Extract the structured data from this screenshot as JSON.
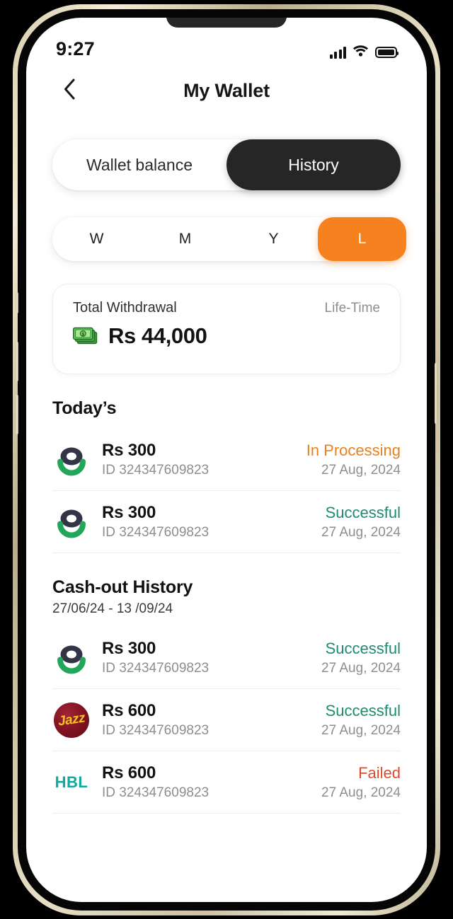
{
  "status_bar": {
    "time": "9:27",
    "signal_icon": "signal-bars-icon",
    "wifi_icon": "wifi-icon",
    "battery_icon": "battery-full-icon"
  },
  "header": {
    "back_icon": "chevron-left-icon",
    "title": "My Wallet"
  },
  "wallet_tabs": {
    "items": [
      {
        "label": "Wallet balance",
        "active": false
      },
      {
        "label": "History",
        "active": true
      }
    ],
    "active_bg": "#262626"
  },
  "period_tabs": {
    "items": [
      {
        "label": "W",
        "active": false
      },
      {
        "label": "M",
        "active": false
      },
      {
        "label": "Y",
        "active": false
      },
      {
        "label": "L",
        "active": true
      }
    ],
    "active_bg": "#F5821F"
  },
  "summary": {
    "label": "Total Withdrawal",
    "period": "Life-Time",
    "icon": "money-banknotes-icon",
    "amount": "Rs 44,000"
  },
  "today_section": {
    "heading": "Today’s",
    "rows": [
      {
        "logo": "easypaisa-logo",
        "amount": "Rs 300",
        "id": "ID 324347609823",
        "status": "In Processing",
        "status_kind": "processing",
        "status_color": "#E8821E",
        "date": "27 Aug, 2024"
      },
      {
        "logo": "easypaisa-logo",
        "amount": "Rs 300",
        "id": "ID 324347609823",
        "status": "Successful",
        "status_kind": "successful",
        "status_color": "#1E8C6E",
        "date": "27 Aug, 2024"
      }
    ]
  },
  "cashout_section": {
    "heading": "Cash-out History",
    "date_range": "27/06/24 - 13 /09/24",
    "rows": [
      {
        "logo": "easypaisa-logo",
        "amount": "Rs 300",
        "id": "ID 324347609823",
        "status": "Successful",
        "status_kind": "successful",
        "status_color": "#1E8C6E",
        "date": "27 Aug, 2024"
      },
      {
        "logo": "jazz-logo",
        "logo_text": "Jazz",
        "amount": "Rs 600",
        "id": "ID 324347609823",
        "status": "Successful",
        "status_kind": "successful",
        "status_color": "#1E8C6E",
        "date": "27 Aug, 2024"
      },
      {
        "logo": "hbl-logo",
        "logo_text": "HBL",
        "amount": "Rs 600",
        "id": "ID 324347609823",
        "status": "Failed",
        "status_kind": "failed",
        "status_color": "#DC4B2C",
        "date": "27 Aug, 2024"
      }
    ]
  }
}
